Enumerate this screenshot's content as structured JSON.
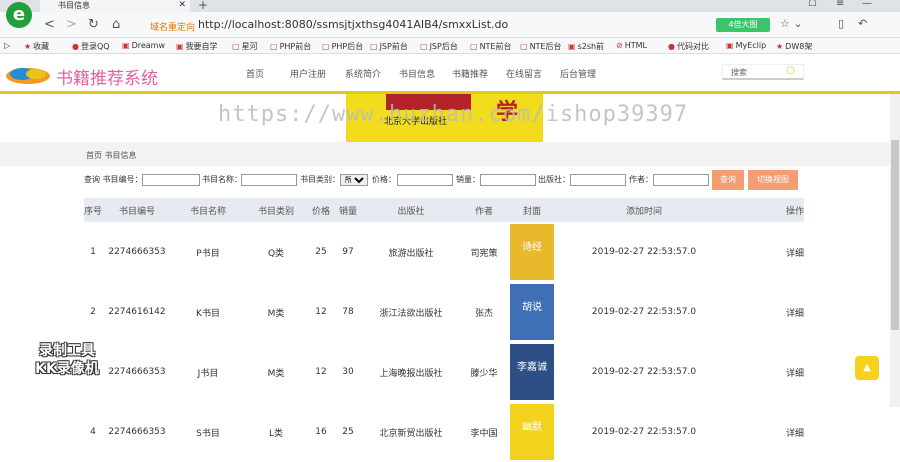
{
  "browser": {
    "tab_title": "书目信息",
    "logo": "e",
    "address_prefix": "域名重定向",
    "url": "http://localhost:8080/ssmsjtjxthsg4041AIB4/smxxList.do",
    "speed_badge": "4倍大图",
    "bookmarks": [
      "收藏",
      "登录QQ",
      "Dreamw",
      "我要自学",
      "星河",
      "PHP前台",
      "PHP后台",
      "JSP前台",
      "JSP后台",
      "NTE前台",
      "NTE后台",
      "s2sh前",
      "HTML",
      "代码对比",
      "MyEclip",
      "DW8架"
    ]
  },
  "site": {
    "title": "书籍推荐系统",
    "nav": [
      "首页",
      "用户注册",
      "系统简介",
      "书目信息",
      "书籍推荐",
      "在线留言",
      "后台管理"
    ],
    "search_placeholder": "搜索"
  },
  "watermark": "https://www.huzhan.com/ishop39397",
  "banner_text": "北京大学出版社",
  "banner_big": "学",
  "breadcrumb": "首页 书目信息",
  "filters": {
    "label_isbn": "查询 书目编号：",
    "label_name": "书目名称：",
    "label_category": "书目类别：",
    "category_selected": "所有",
    "label_price": "价格：",
    "label_sales": "销量：",
    "label_publisher": "出版社：",
    "label_author": "作者：",
    "search_button": "查询",
    "toggle_button": "切换视图"
  },
  "table": {
    "headers": [
      "序号",
      "书目编号",
      "书目名称",
      "书目类别",
      "价格",
      "销量",
      "出版社",
      "作者",
      "封面",
      "添加时间",
      "操作"
    ],
    "rows": [
      {
        "no": "1",
        "isbn": "2274666353",
        "name": "P书目",
        "category": "Q类",
        "price": "25",
        "sales": "97",
        "publisher": "旅游出版社",
        "author": "司宪策",
        "cover_text": "诗经",
        "cover_color": "#e8b92a",
        "time": "2019-02-27 22:53:57.0",
        "action": "详细"
      },
      {
        "no": "2",
        "isbn": "2274616142",
        "name": "K书目",
        "category": "M类",
        "price": "12",
        "sales": "78",
        "publisher": "浙江法欲出版社",
        "author": "张杰",
        "cover_text": "胡说",
        "cover_color": "#3f6fb5",
        "time": "2019-02-27 22:53:57.0",
        "action": "详细"
      },
      {
        "no": "3",
        "isbn": "2274666353",
        "name": "J书目",
        "category": "M类",
        "price": "12",
        "sales": "30",
        "publisher": "上海晚报出版社",
        "author": "滕少华",
        "cover_text": "李嘉诚",
        "cover_color": "#2d4f86",
        "time": "2019-02-27 22:53:57.0",
        "action": "详细"
      },
      {
        "no": "4",
        "isbn": "2274666353",
        "name": "S书目",
        "category": "L类",
        "price": "16",
        "sales": "25",
        "publisher": "北京新贸出版社",
        "author": "李中国",
        "cover_text": "幽默",
        "cover_color": "#f2d21c",
        "time": "2019-02-27 22:53:57.0",
        "action": "详细"
      }
    ]
  },
  "record_stamp": [
    "录制工具",
    "KK录像机"
  ],
  "totop": "▲"
}
